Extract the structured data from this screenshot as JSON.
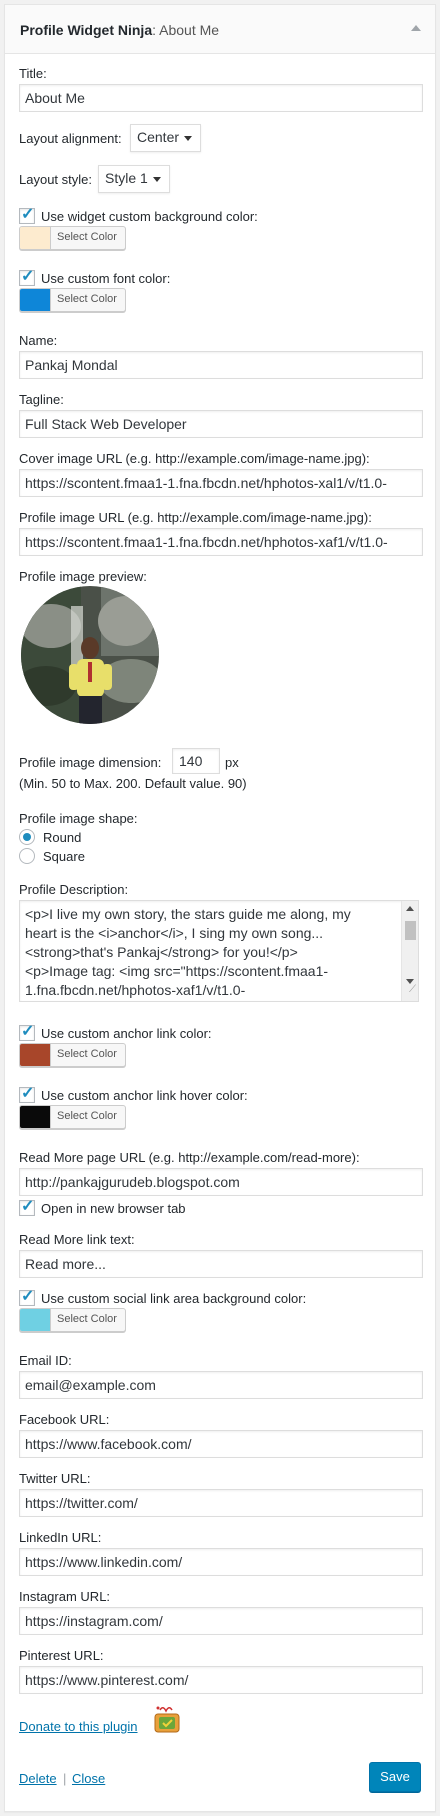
{
  "header": {
    "plugin": "Profile Widget Ninja",
    "instance": "About Me",
    "separator": ": "
  },
  "title": {
    "label": "Title:",
    "value": "About Me"
  },
  "alignment": {
    "label": "Layout alignment:",
    "value": "Center"
  },
  "style": {
    "label": "Layout style:",
    "value": "Style 1"
  },
  "bg_color": {
    "label": "Use widget custom background color:",
    "checked": true,
    "button": "Select Color",
    "color": "#fdebcf"
  },
  "font_color": {
    "label": "Use custom font color:",
    "checked": true,
    "button": "Select Color",
    "color": "#0e86d8"
  },
  "name": {
    "label": "Name:",
    "value": "Pankaj Mondal"
  },
  "tagline": {
    "label": "Tagline:",
    "value": "Full Stack Web Developer"
  },
  "cover_url": {
    "label": "Cover image URL (e.g. http://example.com/image-name.jpg):",
    "value": "https://scontent.fmaa1-1.fna.fbcdn.net/hphotos-xal1/v/t1.0-"
  },
  "profile_url": {
    "label": "Profile image URL (e.g. http://example.com/image-name.jpg):",
    "value": "https://scontent.fmaa1-1.fna.fbcdn.net/hphotos-xaf1/v/t1.0-"
  },
  "preview": {
    "label": "Profile image preview:"
  },
  "dimension": {
    "label": "Profile image dimension:",
    "value": "140",
    "unit": "px",
    "hint": "(Min. 50 to Max. 200. Default value. 90)"
  },
  "shape": {
    "label": "Profile image shape:",
    "options": [
      "Round",
      "Square"
    ],
    "selected": "Round"
  },
  "description": {
    "label": "Profile Description:",
    "lines": [
      "<p>I live my own story, the stars guide me along, my",
      "heart is the <i>anchor</i>, I sing my own song...",
      "<strong>that's Pankaj</strong> for you!</p>",
      "<p>Image tag: <img src=\"https://scontent.fmaa1-",
      "1.fna.fbcdn.net/hphotos-xaf1/v/t1.0-"
    ]
  },
  "anchor_color": {
    "label": "Use custom anchor link color:",
    "checked": true,
    "button": "Select Color",
    "color": "#a8462a"
  },
  "anchor_hover_color": {
    "label": "Use custom anchor link hover color:",
    "checked": true,
    "button": "Select Color",
    "color": "#0a0a0a"
  },
  "read_more": {
    "label": "Read More page URL (e.g. http://example.com/read-more):",
    "value": "http://pankajgurudeb.blogspot.com",
    "new_tab_label": "Open in new browser tab",
    "new_tab": true
  },
  "read_more_text": {
    "label": "Read More link text:",
    "value": "Read more..."
  },
  "social_bg": {
    "label": "Use custom social link area background color:",
    "checked": true,
    "button": "Select Color",
    "color": "#6fd0e3"
  },
  "email": {
    "label": "Email ID:",
    "value": "email@example.com"
  },
  "facebook": {
    "label": "Facebook URL:",
    "value": "https://www.facebook.com/"
  },
  "twitter": {
    "label": "Twitter URL:",
    "value": "https://twitter.com/"
  },
  "linkedin": {
    "label": "LinkedIn URL:",
    "value": "https://www.linkedin.com/"
  },
  "instagram": {
    "label": "Instagram URL:",
    "value": "https://instagram.com/"
  },
  "pinterest": {
    "label": "Pinterest URL:",
    "value": "https://www.pinterest.com/"
  },
  "footer": {
    "donate": "Donate to this plugin",
    "delete": "Delete",
    "sep": "|",
    "close": "Close",
    "save": "Save"
  }
}
